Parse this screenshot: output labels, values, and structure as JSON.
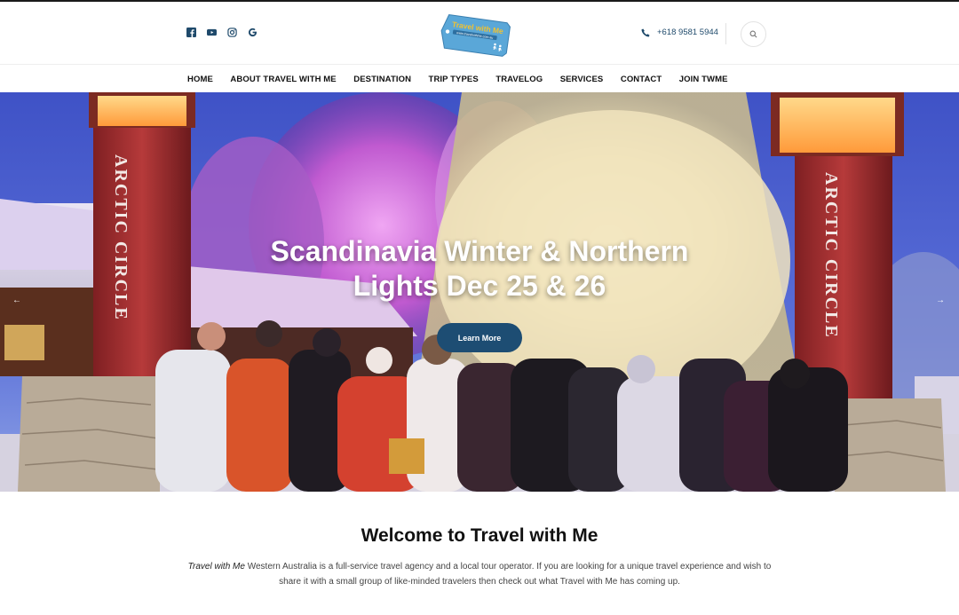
{
  "header": {
    "social": [
      {
        "name": "facebook-icon"
      },
      {
        "name": "youtube-icon"
      },
      {
        "name": "instagram-icon"
      },
      {
        "name": "google-icon"
      }
    ],
    "logo": {
      "line1": "Travel with Me",
      "line2": "www.travelwithme.com.au"
    },
    "phone": "+618 9581 5944"
  },
  "nav": {
    "items": [
      "HOME",
      "ABOUT TRAVEL WITH ME",
      "DESTINATION",
      "TRIP TYPES",
      "TRAVELOG",
      "SERVICES",
      "CONTACT",
      "JOIN TWME"
    ]
  },
  "hero": {
    "title_line1": "Scandinavia Winter & Northern",
    "title_line2": "Lights Dec 25 & 26",
    "button": "Learn More",
    "sign_text": "ARCTIC CIRCLE",
    "prev_arrow": "←",
    "next_arrow": "→"
  },
  "welcome": {
    "heading": "Welcome to Travel with Me",
    "brand": "Travel with Me",
    "body": " Western Australia is a full-service travel agency and a local tour operator. If you are looking for a unique travel experience and wish to share it with a small group of like-minded travelers then check out what Travel with Me has coming up."
  },
  "colors": {
    "accent": "#1d4d73",
    "nav_text": "#111111",
    "logo_tag": "#5aa7d8",
    "logo_text": "#f2c230"
  }
}
